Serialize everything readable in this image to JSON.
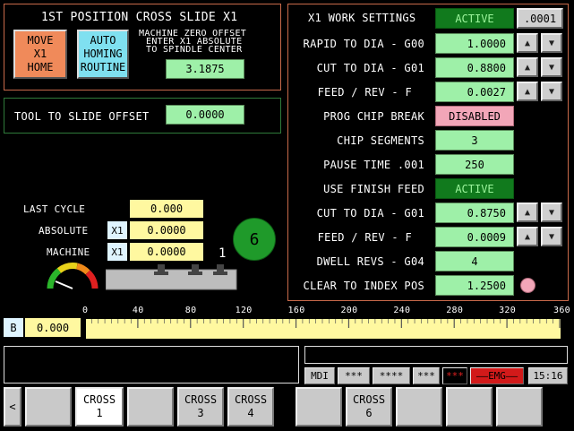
{
  "top_left": {
    "title": "1ST POSITION CROSS SLIDE X1",
    "move_home_label": "MOVE\nX1\nHOME",
    "auto_homing_label": "AUTO\nHOMING\nROUTINE",
    "zero_offset_line1": "MACHINE ZERO OFFSET",
    "zero_offset_line2": "ENTER X1 ABSOLUTE",
    "zero_offset_line3": "TO SPINDLE CENTER",
    "zero_offset_value": "3.1875"
  },
  "tool_offset": {
    "label": "TOOL TO SLIDE OFFSET",
    "value": "0.0000"
  },
  "positions": {
    "last_cycle_label": "LAST CYCLE",
    "last_cycle_value": "0.000",
    "absolute_label": "ABSOLUTE",
    "absolute_axis": "X1",
    "absolute_value": "0.0000",
    "machine_label": "MACHINE",
    "machine_axis": "X1",
    "machine_value": "0.0000",
    "tool_number": "6",
    "slide_marker": "1"
  },
  "work_settings": {
    "title": "X1 WORK SETTINGS",
    "status": "ACTIVE",
    "increment": ".0001",
    "rows": [
      {
        "label": "RAPID TO DIA - G00",
        "value": "1.0000"
      },
      {
        "label": "CUT TO DIA - G01",
        "value": "0.8800"
      },
      {
        "label": "FEED / REV - F",
        "value": "0.0027"
      },
      {
        "label": "PROG CHIP BREAK",
        "value": "DISABLED"
      },
      {
        "label": "CHIP SEGMENTS",
        "value": "3"
      },
      {
        "label": "PAUSE TIME .001",
        "value": "250"
      },
      {
        "label": "USE FINISH FEED",
        "value": "ACTIVE"
      },
      {
        "label": "CUT TO DIA - G01",
        "value": "0.8750"
      },
      {
        "label": "FEED / REV - F",
        "value": "0.0009"
      },
      {
        "label": "DWELL REVS - G04",
        "value": "4"
      },
      {
        "label": "CLEAR TO INDEX POS",
        "value": "1.2500"
      }
    ],
    "up_arrow": "▲",
    "down_arrow": "▼"
  },
  "scale": {
    "axis_label": "B",
    "value": "0.000",
    "ticks": [
      "0",
      "40",
      "80",
      "120",
      "160",
      "200",
      "240",
      "280",
      "320",
      "360"
    ]
  },
  "status_bar": {
    "mode": "MDI",
    "s1": "***",
    "s2": "****",
    "s3": "***",
    "s4": "***",
    "emg": "EMG",
    "time": "15:16"
  },
  "function_keys": {
    "back": "<",
    "k1": "",
    "k2": "CROSS\n1",
    "k3": "",
    "k4": "CROSS\n3",
    "k5": "CROSS\n4",
    "k6": "",
    "k7": "CROSS\n6",
    "k8": "",
    "k9": "",
    "k10": ""
  },
  "colors": {
    "orange_button": "#f08a5a",
    "cyan_button": "#7fe0f0",
    "value_green": "#9ef0a8",
    "value_yellow": "#fff8a0",
    "active_green": "#117a1d",
    "disabled_pink": "#f2a6b8",
    "panel_border": "#c86a4a",
    "tool_circle": "#1f9a2a"
  }
}
